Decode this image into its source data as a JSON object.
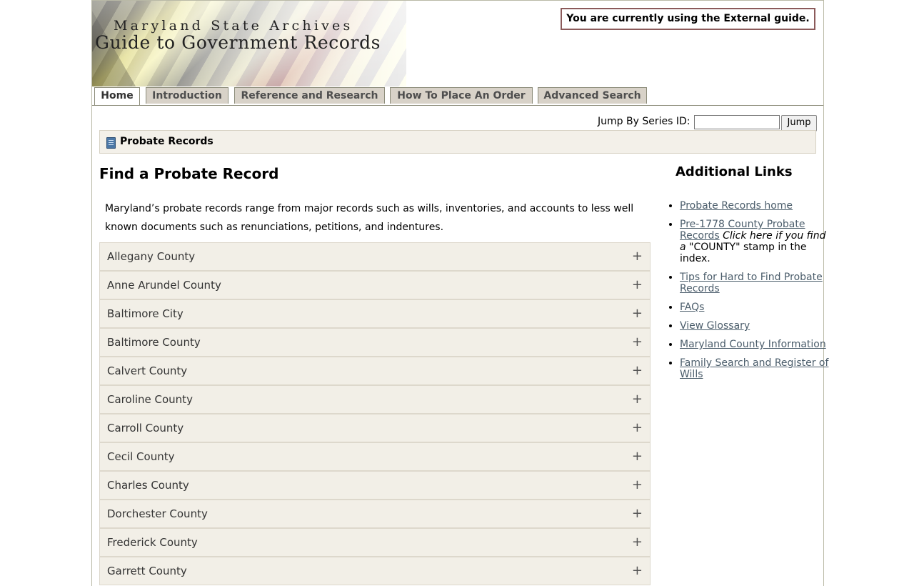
{
  "header": {
    "site_sub": "Maryland State Archives",
    "site_title": "Guide to Government Records",
    "guide_note": "You are currently using the External guide."
  },
  "tabs": [
    {
      "label": "Home",
      "active": true
    },
    {
      "label": "Introduction",
      "active": false
    },
    {
      "label": "Reference and Research",
      "active": false
    },
    {
      "label": "How To Place An Order",
      "active": false
    },
    {
      "label": "Advanced Search",
      "active": false
    }
  ],
  "jump": {
    "label": "Jump By Series ID:",
    "value": "",
    "button": "Jump"
  },
  "breadcrumb": {
    "icon": "book-icon",
    "title": "Probate Records"
  },
  "main": {
    "heading": "Find a Probate Record",
    "intro": "Maryland’s probate records range from major records such as wills, inventories, and accounts to less well known documents such as renunciations, petitions, and indentures.",
    "counties": [
      "Allegany County",
      "Anne Arundel County",
      "Baltimore City",
      "Baltimore County",
      "Calvert County",
      "Caroline County",
      "Carroll County",
      "Cecil County",
      "Charles County",
      "Dorchester County",
      "Frederick County",
      "Garrett County"
    ],
    "expand_symbol": "+"
  },
  "sidebar": {
    "title": "Additional Links",
    "links": [
      {
        "text": "Probate Records home"
      },
      {
        "text": "Pre-1778 County Probate Records",
        "note_italic_1": "Click here if you find a",
        "note_plain": " \"COUNTY\" stamp in the index."
      },
      {
        "text": "Tips for Hard to Find Probate Records"
      },
      {
        "text": "FAQs"
      },
      {
        "text": "View Glossary"
      },
      {
        "text": "Maryland County Information"
      },
      {
        "text": "Family Search and Register of Wills"
      }
    ]
  },
  "colors": {
    "crumb_bg": "#f3f0e9",
    "tab_bg": "#d8d2c8",
    "link": "#4b5d6b",
    "note_border": "#8b5a5a"
  }
}
